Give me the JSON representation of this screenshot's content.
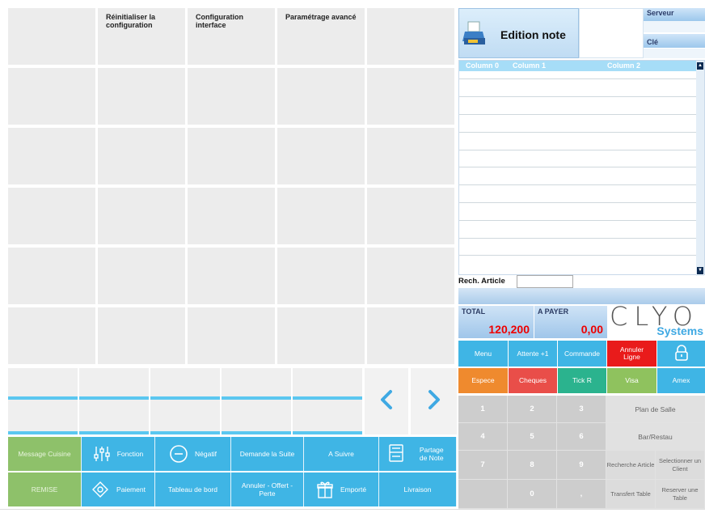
{
  "menu_grid": {
    "headers": [
      "",
      "Réinitialiser la configuration",
      "Configuration interface",
      "Paramétrage avancé",
      ""
    ]
  },
  "carousel": {
    "prev_icon": "chevron-left-icon",
    "next_icon": "chevron-right-icon"
  },
  "bottom_buttons": {
    "message_cuisine": "Message Cuisine",
    "fonction": "Fonction",
    "negatif": "Négatif",
    "demande_suite": "Demande la Suite",
    "a_suivre": "A Suivre",
    "partage_note": "Partage de Note",
    "remise": "REMISE",
    "paiement": "Paiement",
    "tableau_bord": "Tableau de bord",
    "annuler_offert": "Annuler - Offert - Perte",
    "emporte": "Emporté",
    "livraison": "Livraison"
  },
  "header": {
    "edition_note": "Edition note",
    "serveur": "Serveur",
    "cle": "Clé",
    "printer_icon": "printer-icon"
  },
  "order_list": {
    "columns": [
      "Column 0",
      "Column 1",
      "Column 2"
    ]
  },
  "search": {
    "label": "Rech. Article",
    "value": ""
  },
  "totals": {
    "total_label": "TOTAL",
    "total_value": "120,200",
    "a_payer_label": "A PAYER",
    "a_payer_value": "0,00"
  },
  "logo": {
    "brand": "CLYO",
    "sub": "Systems"
  },
  "actions": {
    "menu": "Menu",
    "attente": "Attente +1",
    "commande": "Commande",
    "annuler_ligne": "Annuler Ligne",
    "lock_icon": "lock-icon"
  },
  "payments": {
    "espece": "Espece",
    "cheques": "Cheques",
    "tick_r": "Tick R",
    "visa": "Visa",
    "amex": "Amex"
  },
  "keypad": {
    "k1": "1",
    "k2": "2",
    "k3": "3",
    "k4": "4",
    "k5": "5",
    "k6": "6",
    "k7": "7",
    "k8": "8",
    "k9": "9",
    "k0": "0",
    "kdot": ",",
    "plan_salle": "Plan de Salle",
    "bar_restau": "Bar/Restau",
    "recherche_article": "Recherche Article",
    "selectionner_client": "Selectionner un Client",
    "transfert_table": "Transfert Table",
    "reserver_table": "Reserver une Table"
  },
  "colors": {
    "blue": "#3fb5e5",
    "green": "#8ec16a",
    "orange": "#ef8a2e",
    "red": "#e94e49",
    "teal": "#2bb38e",
    "visa_green": "#8fc25e",
    "cancel_red": "#e91b1b"
  }
}
